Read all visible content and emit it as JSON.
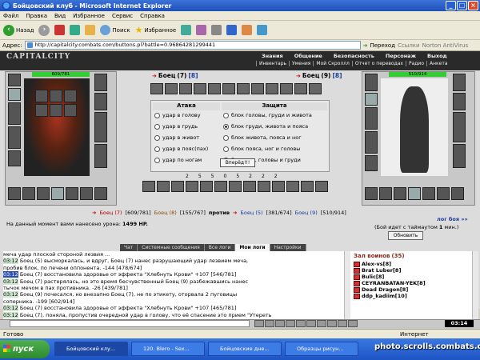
{
  "window": {
    "title": "Бойцовский клуб - Microsoft Internet Explorer",
    "controls": [
      "_",
      "□",
      "×"
    ]
  },
  "menu": [
    "Файл",
    "Правка",
    "Вид",
    "Избранное",
    "Сервис",
    "Справка"
  ],
  "toolbar": {
    "back": "Назад",
    "search": "Поиск",
    "favorites": "Избранное"
  },
  "address": {
    "label": "Адрес:",
    "url": "http://capitalcity.combats.com/buttons.pl?battle=0.96864281299441",
    "go": "Переход",
    "links": "Ссылки",
    "antivirus": "Norton AntiVirus"
  },
  "game": {
    "logo": "CAPITALCITY",
    "nav_top": [
      "Знания",
      "Общение",
      "Безопасность",
      "Персонаж",
      "Выход"
    ],
    "nav_bottom": [
      "Инвентарь",
      "Умения",
      "Мой Скроллл",
      "Отчет о переводах",
      "Радио",
      "Анкета"
    ],
    "player": {
      "name": "Боец",
      "level": "(7)",
      "tag": "[8]",
      "hp": "609/781"
    },
    "opponent": {
      "name": "Боец",
      "level": "(9)",
      "tag": "[8]",
      "hp": "510/914"
    },
    "attack_title": "Атака",
    "defense_title": "Защита",
    "attack_options": [
      "удар в голову",
      "удар в грудь",
      "удар в живот",
      "удар в пояс(пах)",
      "удар по ногам"
    ],
    "defense_options": [
      "блок головы, груди и живота",
      "блок груди, живота и пояса",
      "блок живота, пояса и ног",
      "блок пояса, ног и головы",
      "блок ног, головы и груди"
    ],
    "forward_button": "Вперёд!!!",
    "spell_counts": [
      "2",
      "5",
      "5",
      "0",
      "5",
      "2",
      "2",
      "2"
    ],
    "team_line": {
      "left": [
        {
          "name": "Боец (7)",
          "hp": "[609/781]"
        },
        {
          "name": "Боец (8)",
          "hp": "[155/767]"
        }
      ],
      "vs": "против",
      "right": [
        {
          "name": "Боец (5)",
          "hp": "[381/674]"
        },
        {
          "name": "Боец (9)",
          "hp": "[510/914]"
        }
      ]
    },
    "damage_text": "На данный момент вами нанесено урона:",
    "damage_value": "1499 HP.",
    "log_link": "лог боя »»",
    "timeout_text": "(Бой идет с таймаутом",
    "timeout_value": "1",
    "timeout_unit": "мин.)",
    "refresh_button": "Обновить"
  },
  "chat": {
    "tabs": [
      "Чат",
      "Системные сообщения",
      "Все логи",
      "Мои логи",
      "Настройки"
    ],
    "active_tab": "Мои логи",
    "lines": [
      {
        "ts": "",
        "text": "меча удар плоской стороной лезвия ..."
      },
      {
        "ts": "03:12",
        "text": "Боец (5) высморкалась, и вдруг, Боец (7) нанес разрушающий удар лезвием меча,"
      },
      {
        "ts": "",
        "text": "пробив блок, по печени оппонента. -144 [478/674]"
      },
      {
        "ts": "03:12",
        "text": "Боец (7) восстановила здоровье от эффекта \"Хлебнуть Крови\" +107 [546/781]"
      },
      {
        "ts": "03:12",
        "text": "Боец (7) растерялась, но это время бесчувственный Боец (9) разбежавшись нанес"
      },
      {
        "ts": "",
        "text": "тычок мечом в пах противника. -26 [439/781]"
      },
      {
        "ts": "03:12",
        "text": "Боец (9) почесался, но внезапно Боец (7), не по этикету, оторвала 2 пуговицы"
      },
      {
        "ts": "",
        "text": "соперника. -199 [602/914]"
      },
      {
        "ts": "03:12",
        "text": "Боец (7) восстановила здоровье от эффекта \"Хлебнуть Крови\" +107 [465/781]"
      },
      {
        "ts": "03:12",
        "text": "Боец (7), поняла, пропустив очередной удар в голову, что её спасение это прием \"Утереть"
      }
    ]
  },
  "room": {
    "title": "Зал воинов",
    "count": "(35)",
    "members": [
      "Alex-vs[8]",
      "Brat Luber[8]",
      "Bulic[8]",
      "CEYRANBATAN-YEK[8]",
      "Dead Dragon[8]",
      "ddp_kadiim[10]"
    ]
  },
  "clock": "03:14",
  "statusbar": {
    "left": "Готово",
    "right": "Интернет"
  },
  "taskbar": {
    "start": "пуск",
    "tasks": [
      "Бойцовский клу...",
      "120. Blero - Sex...",
      "Бойцовские дне...",
      "Образцы рисун..."
    ],
    "watermark": "photo.scrolls.combats.com"
  },
  "colors": {
    "hp_bar": "#33cc33",
    "titlebar": "#1f4fb8",
    "player_name": "#b00000",
    "opponent_name": "#1a3b9c"
  }
}
